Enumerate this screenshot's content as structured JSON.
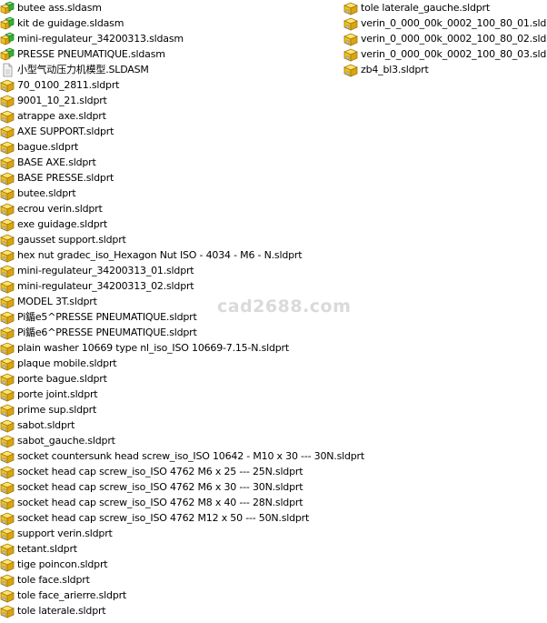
{
  "colors": {
    "part_yellow": "#f3c21b",
    "part_dark": "#a07810",
    "assembly_green": "#32b432",
    "assembly_dark": "#1c7a1c",
    "drawing_gray": "#b8b8b8"
  },
  "left_column": [
    {
      "name": "butee ass.sldasm",
      "icon": "assembly-icon"
    },
    {
      "name": "kit de guidage.sldasm",
      "icon": "assembly-icon"
    },
    {
      "name": "mini-regulateur_34200313.sldasm",
      "icon": "assembly-icon"
    },
    {
      "name": "PRESSE PNEUMATIQUE.sldasm",
      "icon": "assembly-icon"
    },
    {
      "name": "小型气动压力机模型.SLDASM",
      "icon": "generic-file-icon"
    },
    {
      "name": "70_0100_2811.sldprt",
      "icon": "part-icon"
    },
    {
      "name": "9001_10_21.sldprt",
      "icon": "part-icon"
    },
    {
      "name": "atrappe axe.sldprt",
      "icon": "part-icon"
    },
    {
      "name": "AXE SUPPORT.sldprt",
      "icon": "part-icon"
    },
    {
      "name": "bague.sldprt",
      "icon": "part-icon"
    },
    {
      "name": "BASE AXE.sldprt",
      "icon": "part-icon"
    },
    {
      "name": "BASE PRESSE.sldprt",
      "icon": "part-icon"
    },
    {
      "name": "butee.sldprt",
      "icon": "part-icon"
    },
    {
      "name": "ecrou verin.sldprt",
      "icon": "part-icon"
    },
    {
      "name": "exe guidage.sldprt",
      "icon": "part-icon"
    },
    {
      "name": "gausset support.sldprt",
      "icon": "part-icon"
    },
    {
      "name": "hex nut gradec_iso_Hexagon Nut ISO - 4034 - M6 - N.sldprt",
      "icon": "part-icon"
    },
    {
      "name": "mini-regulateur_34200313_01.sldprt",
      "icon": "part-icon"
    },
    {
      "name": "mini-regulateur_34200313_02.sldprt",
      "icon": "part-icon"
    },
    {
      "name": "MODEL 3T.sldprt",
      "icon": "part-icon"
    },
    {
      "name": "Pi鍎e5^PRESSE PNEUMATIQUE.sldprt",
      "icon": "part-icon"
    },
    {
      "name": "Pi鍎e6^PRESSE PNEUMATIQUE.sldprt",
      "icon": "part-icon"
    },
    {
      "name": "plain washer 10669 type nl_iso_ISO 10669-7.15-N.sldprt",
      "icon": "part-icon"
    },
    {
      "name": "plaque mobile.sldprt",
      "icon": "part-icon"
    },
    {
      "name": "porte bague.sldprt",
      "icon": "part-icon"
    },
    {
      "name": "porte joint.sldprt",
      "icon": "part-icon"
    },
    {
      "name": "prime sup.sldprt",
      "icon": "part-icon"
    },
    {
      "name": "sabot.sldprt",
      "icon": "part-icon"
    },
    {
      "name": "sabot_gauche.sldprt",
      "icon": "part-icon"
    },
    {
      "name": "socket countersunk head screw_iso_ISO 10642 - M10 x 30 --- 30N.sldprt",
      "icon": "part-icon"
    },
    {
      "name": "socket head cap screw_iso_ISO 4762 M6 x 25 --- 25N.sldprt",
      "icon": "part-icon"
    },
    {
      "name": "socket head cap screw_iso_ISO 4762 M6 x 30 --- 30N.sldprt",
      "icon": "part-icon"
    },
    {
      "name": "socket head cap screw_iso_ISO 4762 M8 x 40 --- 28N.sldprt",
      "icon": "part-icon"
    },
    {
      "name": "socket head cap screw_iso_ISO 4762 M12 x 50 --- 50N.sldprt",
      "icon": "part-icon"
    },
    {
      "name": "support verin.sldprt",
      "icon": "part-icon"
    },
    {
      "name": "tetant.sldprt",
      "icon": "part-icon"
    },
    {
      "name": "tige poincon.sldprt",
      "icon": "part-icon"
    },
    {
      "name": "tole face.sldprt",
      "icon": "part-icon"
    },
    {
      "name": "tole face_arierre.sldprt",
      "icon": "part-icon"
    },
    {
      "name": "tole laterale.sldprt",
      "icon": "part-icon"
    }
  ],
  "right_column": [
    {
      "name": "tole laterale_gauche.sldprt",
      "icon": "part-icon"
    },
    {
      "name": "verin_0_000_00k_0002_100_80_01.sldprt",
      "icon": "part-icon"
    },
    {
      "name": "verin_0_000_00k_0002_100_80_02.sldprt",
      "icon": "part-icon"
    },
    {
      "name": "verin_0_000_00k_0002_100_80_03.sldprt",
      "icon": "part-icon"
    },
    {
      "name": "zb4_bl3.sldprt",
      "icon": "part-icon"
    }
  ],
  "watermark": "cad2688.com"
}
